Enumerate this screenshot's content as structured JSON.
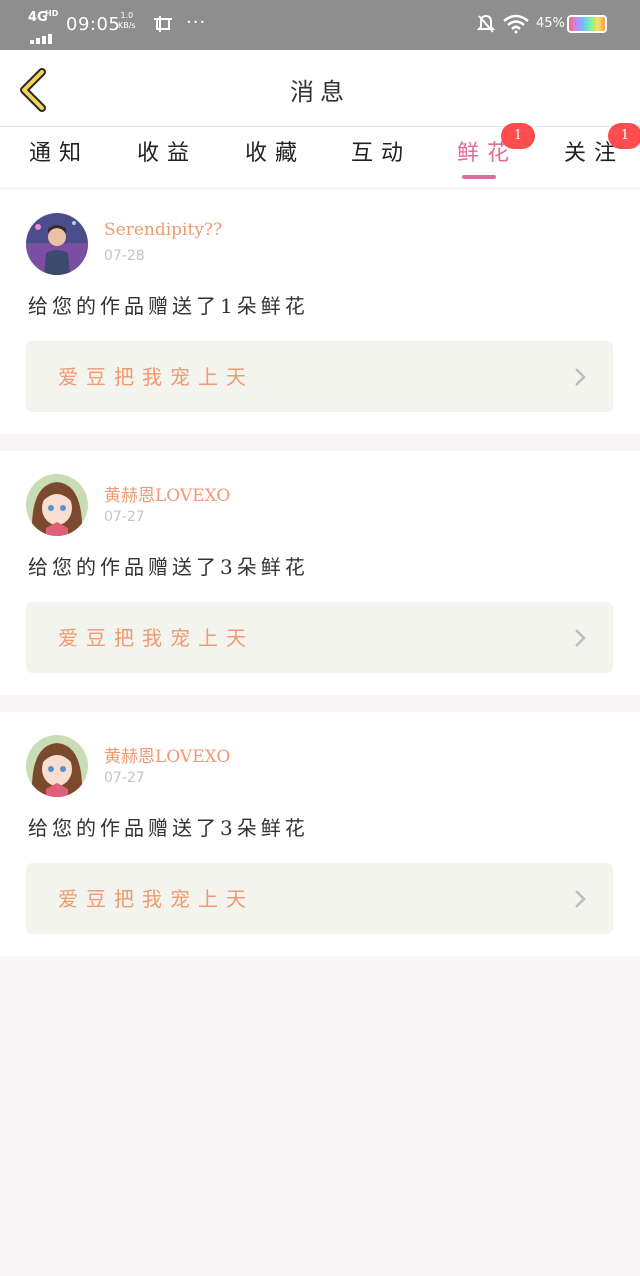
{
  "status_bar": {
    "network": "4G",
    "network_sup": "HD",
    "time": "09:05",
    "speed_top": "1.0",
    "speed_bottom": "KB/s",
    "more": "···",
    "battery_pct": "45%",
    "battery_level": 0.45
  },
  "header": {
    "title": "消息"
  },
  "tabs": [
    {
      "label": "通知",
      "active": false
    },
    {
      "label": "收益",
      "active": false
    },
    {
      "label": "收藏",
      "active": false
    },
    {
      "label": "互动",
      "active": false
    },
    {
      "label": "鲜花",
      "active": true,
      "badge": "1"
    },
    {
      "label": "关注",
      "active": false,
      "badge": "1"
    }
  ],
  "messages": [
    {
      "user": "Serendipity??",
      "date": "07-28",
      "text": "给您的作品赠送了1朵鲜花",
      "work_title": "爱豆把我宠上天"
    },
    {
      "user": "黄赫恩LOVEXO",
      "date": "07-27",
      "text": "给您的作品赠送了3朵鲜花",
      "work_title": "爱豆把我宠上天"
    },
    {
      "user": "黄赫恩LOVEXO",
      "date": "07-27",
      "text": "给您的作品赠送了3朵鲜花",
      "work_title": "爱豆把我宠上天"
    }
  ],
  "colors": {
    "accent_pink": "#e06c9a",
    "username_orange": "#ef9a70",
    "badge_red": "#ff4d4f",
    "card_bg": "#f4f4ee"
  }
}
